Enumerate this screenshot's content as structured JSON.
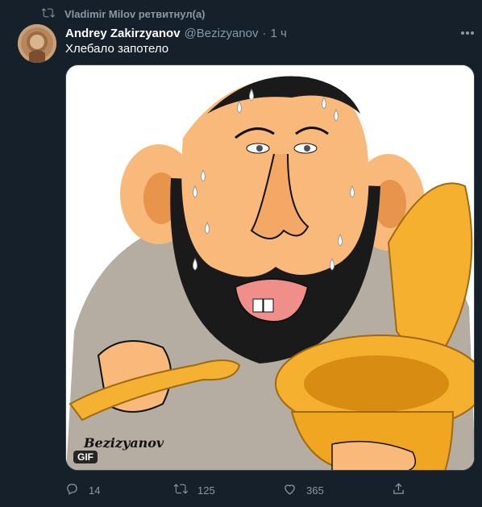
{
  "retweet": {
    "label": "Vladimir Milov ретвитнул(а)",
    "icon": "retweet-icon"
  },
  "author": {
    "name": "Andrey Zakirzyanov",
    "handle": "@Bezizyanov",
    "separator": "·",
    "time": "1 ч"
  },
  "tweet": {
    "text": "Хлебало запотело",
    "media_badge": "GIF",
    "media_signature": "Bezizyanov"
  },
  "actions": {
    "reply_count": "14",
    "retweet_count": "125",
    "like_count": "365"
  },
  "colors": {
    "background": "#15202b",
    "secondary_text": "#8899a6",
    "primary_text": "#ffffff"
  }
}
